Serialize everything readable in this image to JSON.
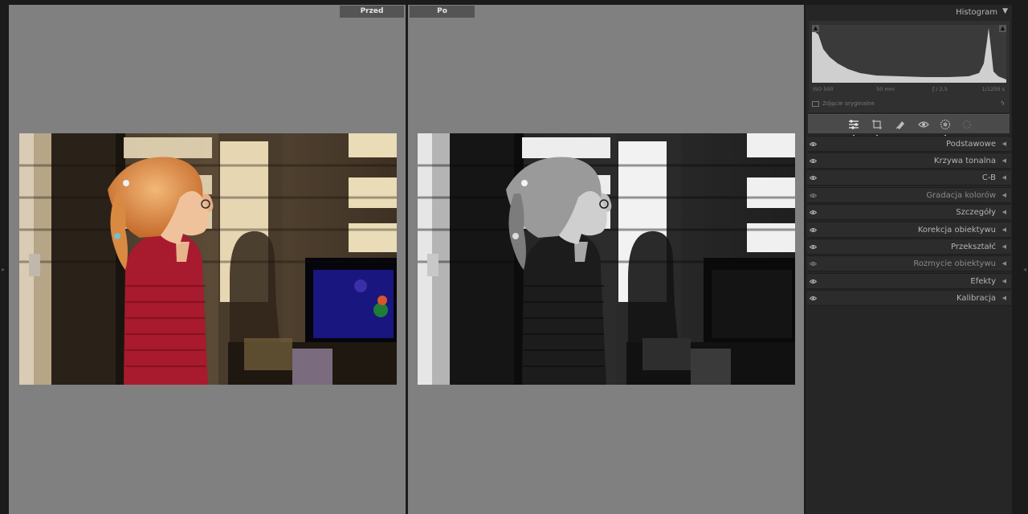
{
  "compare": {
    "before_label": "Przed",
    "after_label": "Po"
  },
  "histogram": {
    "title": "Histogram",
    "toggle_icon": "triangle-down-icon",
    "iso": "ISO 500",
    "focal": "50 mm",
    "aperture": "ƒ / 2,5",
    "shutter": "1/1250 s",
    "original_label": "Zdjęcie oryginalne"
  },
  "tools": [
    {
      "name": "edit-sliders-icon",
      "active": true
    },
    {
      "name": "crop-icon",
      "active": false
    },
    {
      "name": "healing-icon",
      "active": false
    },
    {
      "name": "red-eye-icon",
      "active": false
    },
    {
      "name": "masking-icon",
      "active": false
    },
    {
      "name": "presets-icon",
      "active": false
    }
  ],
  "sections": [
    {
      "label": "Podstawowe",
      "visible": true
    },
    {
      "label": "Krzywa tonalna",
      "visible": true
    },
    {
      "label": "C-B",
      "visible": true
    },
    {
      "label": "Gradacja kolorów",
      "visible": false
    },
    {
      "label": "Szczegóły",
      "visible": true
    },
    {
      "label": "Korekcja obiektywu",
      "visible": true
    },
    {
      "label": "Przekształć",
      "visible": true
    },
    {
      "label": "Rozmycie obiektywu",
      "visible": false
    },
    {
      "label": "Efekty",
      "visible": true
    },
    {
      "label": "Kalibracja",
      "visible": true
    }
  ],
  "colors": {
    "pane_bg": "#808080",
    "panel_bg": "#262626",
    "label_bg": "#545454"
  }
}
